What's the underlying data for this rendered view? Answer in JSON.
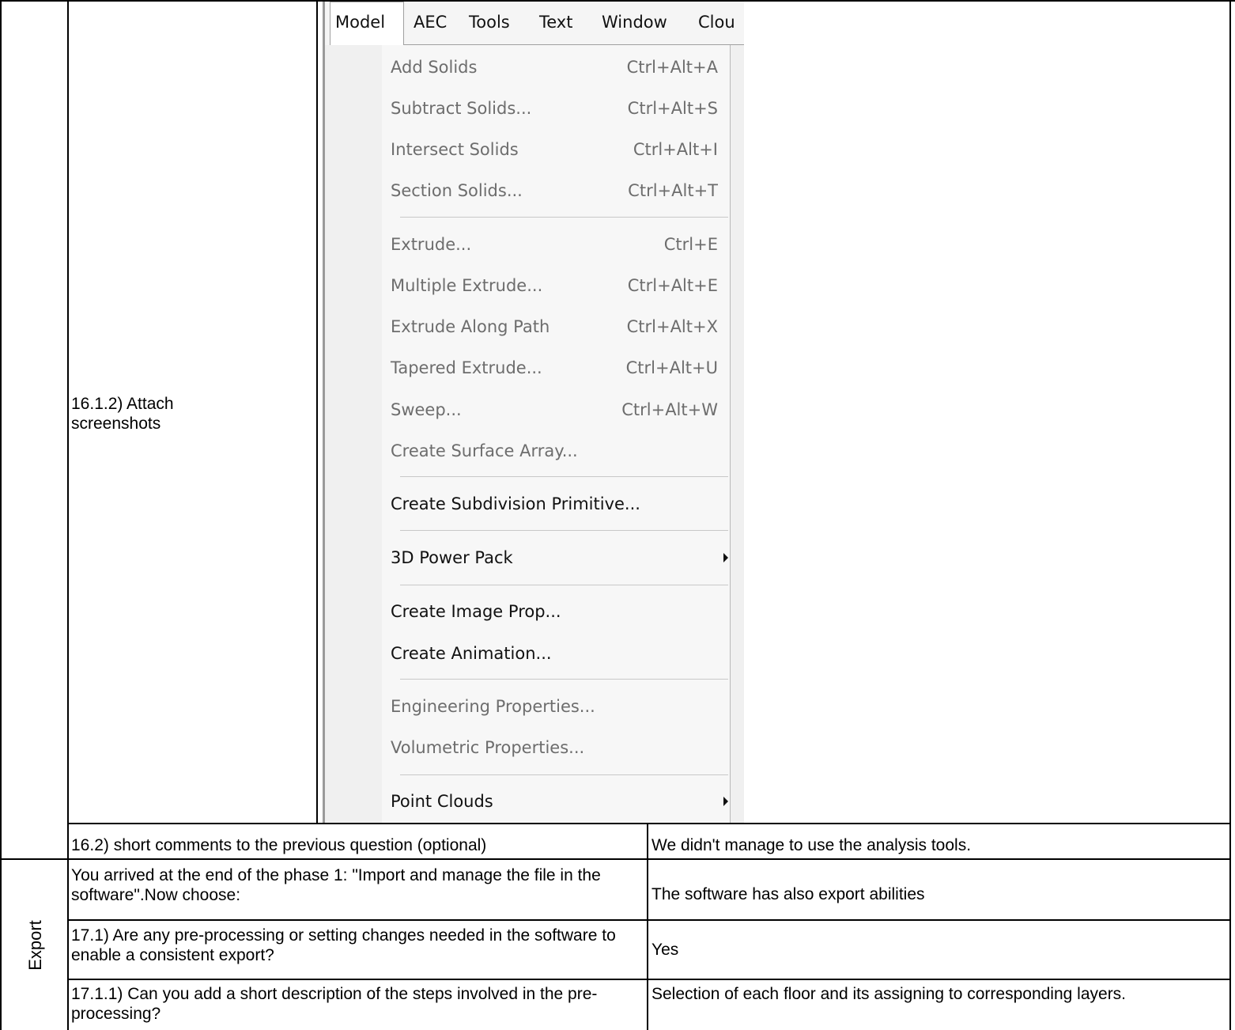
{
  "rows": {
    "attach_label": "16.1.2) Attach screenshots",
    "comments_q": "16.2) short comments to the previous question (optional)",
    "comments_a": "We didn't manage to use the analysis tools.",
    "export_section": "Export",
    "end_phase_q": "You arrived at the end of the phase 1: \"Import and manage the file in the software\".Now choose:",
    "end_phase_a": "The software has also export abilities",
    "preproc_q": "17.1) Are any pre-processing or setting changes needed in the software to enable a consistent export?",
    "preproc_a": "Yes",
    "steps_q": "17.1.1) Can you add a short description of the steps involved in the pre-processing?",
    "steps_a": "Selection of each floor and its assigning to corresponding layers."
  },
  "menubar": {
    "items": [
      "Model",
      "AEC",
      "Tools",
      "Text",
      "Window",
      "Clou"
    ],
    "active": "Model"
  },
  "menu": {
    "items": [
      {
        "label": "Add Solids",
        "shortcut": "Ctrl+Alt+A",
        "enabled": false
      },
      {
        "label": "Subtract Solids...",
        "shortcut": "Ctrl+Alt+S",
        "enabled": false
      },
      {
        "label": "Intersect Solids",
        "shortcut": "Ctrl+Alt+I",
        "enabled": false
      },
      {
        "label": "Section Solids...",
        "shortcut": "Ctrl+Alt+T",
        "enabled": false
      },
      {
        "label": "Extrude...",
        "shortcut": "Ctrl+E",
        "enabled": false
      },
      {
        "label": "Multiple Extrude...",
        "shortcut": "Ctrl+Alt+E",
        "enabled": false
      },
      {
        "label": "Extrude Along Path",
        "shortcut": "Ctrl+Alt+X",
        "enabled": false
      },
      {
        "label": "Tapered Extrude...",
        "shortcut": "Ctrl+Alt+U",
        "enabled": false
      },
      {
        "label": "Sweep...",
        "shortcut": "Ctrl+Alt+W",
        "enabled": false
      },
      {
        "label": "Create Surface Array...",
        "shortcut": "",
        "enabled": false
      },
      {
        "label": "Create Subdivision Primitive...",
        "shortcut": "",
        "enabled": true
      },
      {
        "label": "3D Power Pack",
        "shortcut": "",
        "enabled": true,
        "submenu": true
      },
      {
        "label": "Create Image Prop...",
        "shortcut": "",
        "enabled": true
      },
      {
        "label": "Create Animation...",
        "shortcut": "",
        "enabled": true
      },
      {
        "label": "Engineering Properties...",
        "shortcut": "",
        "enabled": false
      },
      {
        "label": "Volumetric Properties...",
        "shortcut": "",
        "enabled": false
      },
      {
        "label": "Point Clouds",
        "shortcut": "",
        "enabled": true,
        "submenu": true
      }
    ]
  }
}
